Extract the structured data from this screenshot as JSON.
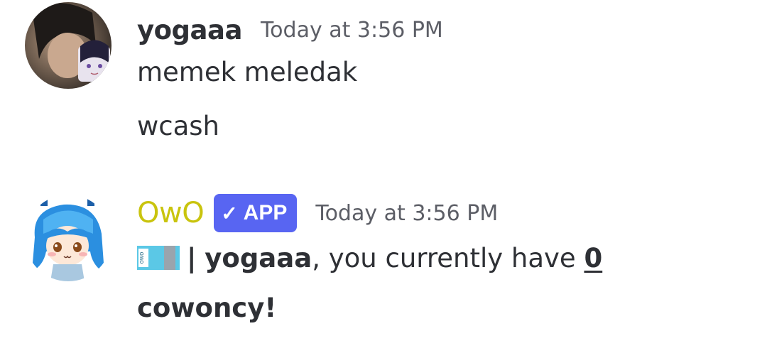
{
  "messages": [
    {
      "author": "yogaaa",
      "author_color": "#2e3035",
      "timestamp": "Today at 3:56 PM",
      "lines": [
        "memek meledak",
        "wcash"
      ]
    },
    {
      "author": "OwO",
      "author_color": "#c9c40e",
      "badge": {
        "check": "✓",
        "label": "APP",
        "color": "#5865f2"
      },
      "timestamp": "Today at 3:56 PM",
      "reply": {
        "emoji_icon": "owo-cash-icon",
        "separator": "|",
        "mention": "yogaaa",
        "text_before": ", you currently have ",
        "amount": "0",
        "currency": "cowoncy!"
      }
    }
  ]
}
